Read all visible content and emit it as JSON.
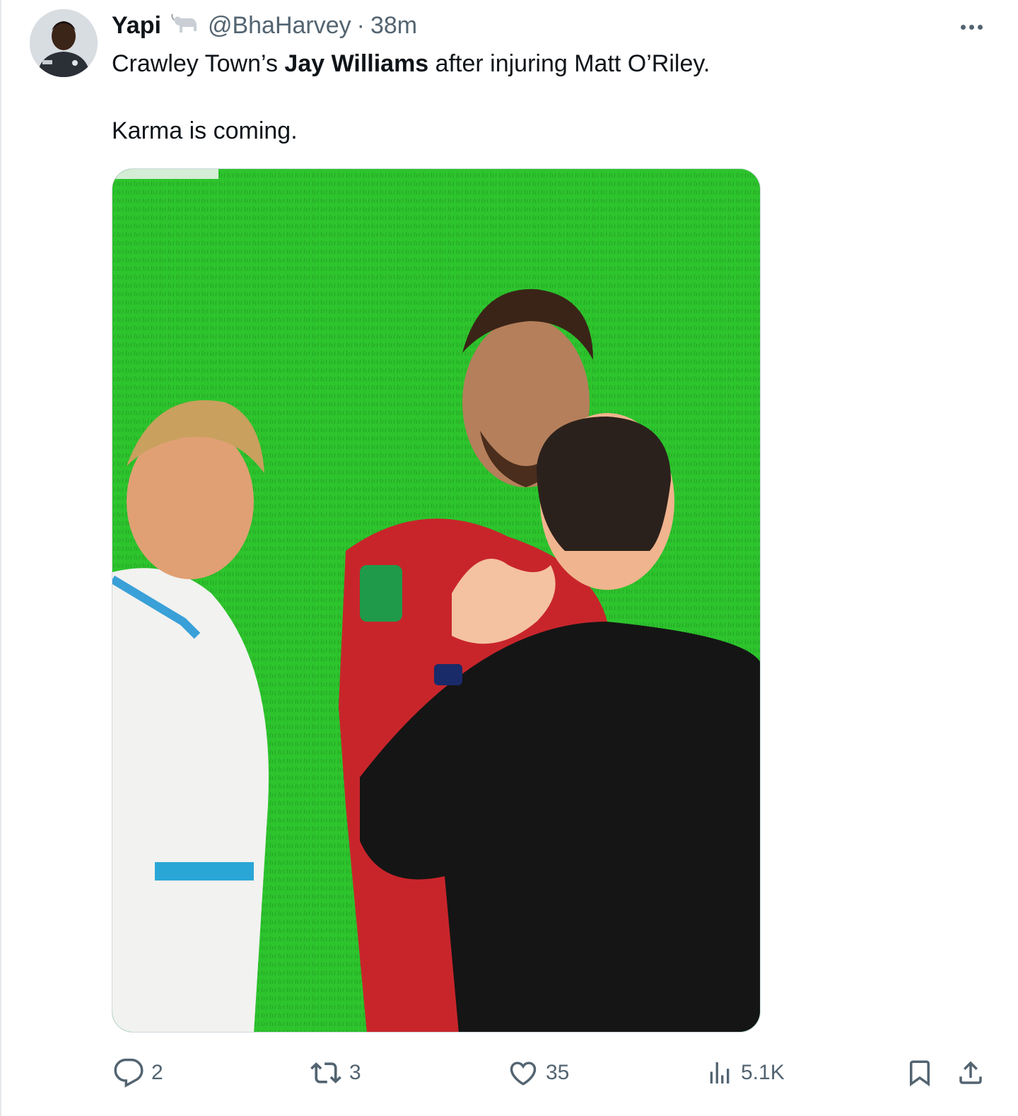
{
  "author": {
    "display_name": "Yapi",
    "handle": "@BhaHarvey",
    "separator": "·",
    "time": "38m"
  },
  "tweet": {
    "line1_before": "Crawley Town’s ",
    "line1_bold": "Jay Williams",
    "line1_after": " after injuring Matt O’Riley.",
    "line2": "Karma is coming."
  },
  "actions": {
    "replies": "2",
    "reposts": "3",
    "likes": "35",
    "views": "5.1K"
  },
  "colors": {
    "muted": "#536471",
    "text": "#0f1419",
    "pitch": "#2cc22c"
  },
  "icons": [
    "goat-icon",
    "more-icon",
    "reply-icon",
    "repost-icon",
    "like-icon",
    "views-icon",
    "bookmark-icon",
    "share-icon"
  ]
}
